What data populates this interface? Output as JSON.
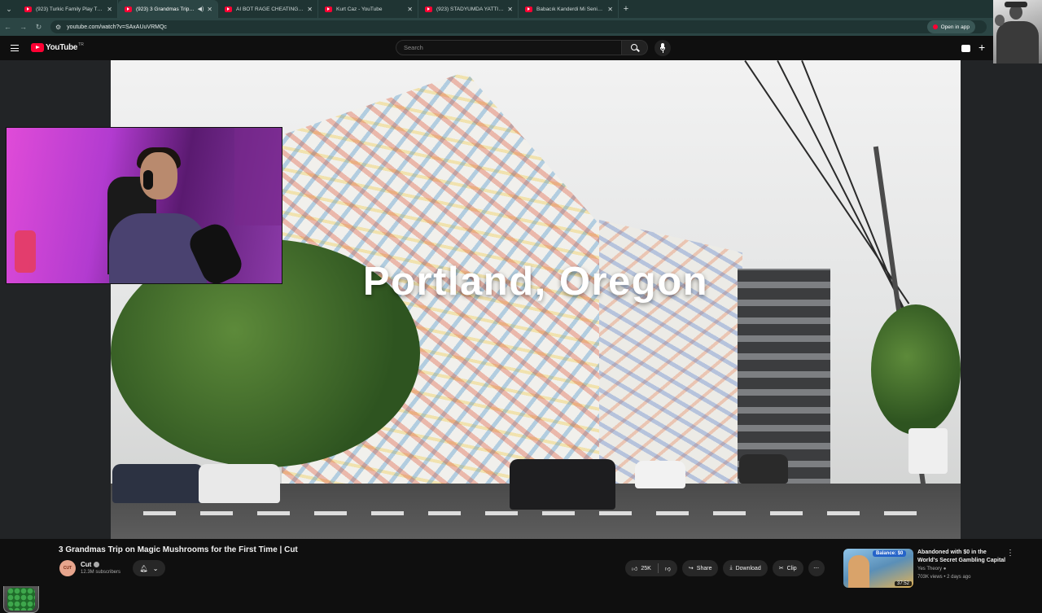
{
  "browser": {
    "tabs": [
      {
        "title": "(923) Turkic Family Play The Te...",
        "active": false
      },
      {
        "title": "(923) 3 Grandmas Trip on M...",
        "active": true,
        "audio": true
      },
      {
        "title": "AI BOT RAGE CHEATING ON PA...",
        "active": false
      },
      {
        "title": "Kurt Caz - YouTube",
        "active": false
      },
      {
        "title": "(923) STADYUMDA YATTIĞIN YE...",
        "active": false
      },
      {
        "title": "Babacık Kanderdi Mi Seni? - You...",
        "active": false
      }
    ],
    "url": "youtube.com/watch?v=SAxAUuVRMQc",
    "open_in_app": "Open in app"
  },
  "youtube": {
    "logo_text": "YouTube",
    "region": "TR",
    "search_placeholder": "Search"
  },
  "video": {
    "overlay_text": "Portland, Oregon",
    "title": "3 Grandmas Trip on Magic Mushrooms for the First Time | Cut",
    "channel_avatar_text": "CUT",
    "channel_name": "Cut",
    "subscribers": "12.3M subscribers",
    "likes": "25K",
    "share_label": "Share",
    "download_label": "Download",
    "clip_label": "Clip"
  },
  "recommendation": {
    "badge": "Balance: $0",
    "duration": "37:52",
    "title": "Abandoned with $0 in the World's Secret Gambling Capital",
    "channel": "Yes Theory",
    "meta": "703K views • 2 days ago"
  },
  "colors": {
    "youtube_red": "#ff0033",
    "browser_chrome": "#1f3433",
    "background": "#0f0f0f"
  }
}
